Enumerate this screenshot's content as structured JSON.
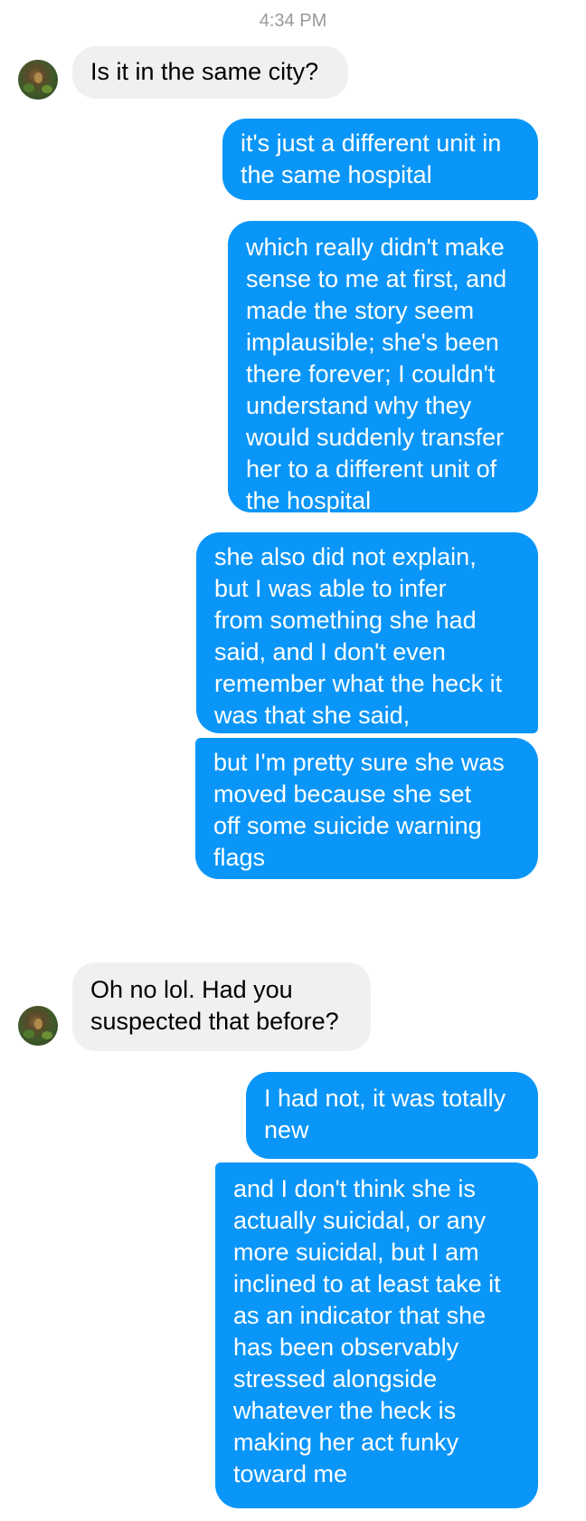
{
  "conversation": {
    "timestamp": "4:34 PM",
    "messages": [
      {
        "sender": "contact",
        "text": "Is it in the same city?"
      },
      {
        "sender": "me",
        "text": "it's just a different unit in\nthe same hospital"
      },
      {
        "sender": "me",
        "text": "which really didn't make\nsense to me at first, and\nmade the story seem\nimplausible; she's been\nthere forever; I couldn't\nunderstand why they\nwould suddenly transfer\nher to a different unit of\nthe hospital"
      },
      {
        "sender": "me",
        "text": "she also did not explain,\nbut I was able to infer\nfrom something she had\nsaid, and I don't even\nremember what the heck it\nwas that she said,"
      },
      {
        "sender": "me",
        "text": "but I'm pretty sure she was\nmoved because she set\noff some suicide warning\nflags"
      },
      {
        "sender": "contact",
        "text": "Oh no lol. Had you\nsuspected that before?"
      },
      {
        "sender": "me",
        "text": "I had not, it was totally\nnew"
      },
      {
        "sender": "me",
        "text": "and I don't think she is\nactually suicidal, or any\nmore suicidal, but I am\ninclined to at least take it\nas an indicator that she\nhas been observably\nstressed alongside\nwhatever the heck is\nmaking her act funky\ntoward me"
      }
    ]
  },
  "colors": {
    "outgoing_bubble": "#0a96f8",
    "incoming_bubble": "#f0f0f0",
    "timestamp_text": "#9a9a9a"
  },
  "icons": {
    "avatar": "contact-avatar-photo"
  }
}
